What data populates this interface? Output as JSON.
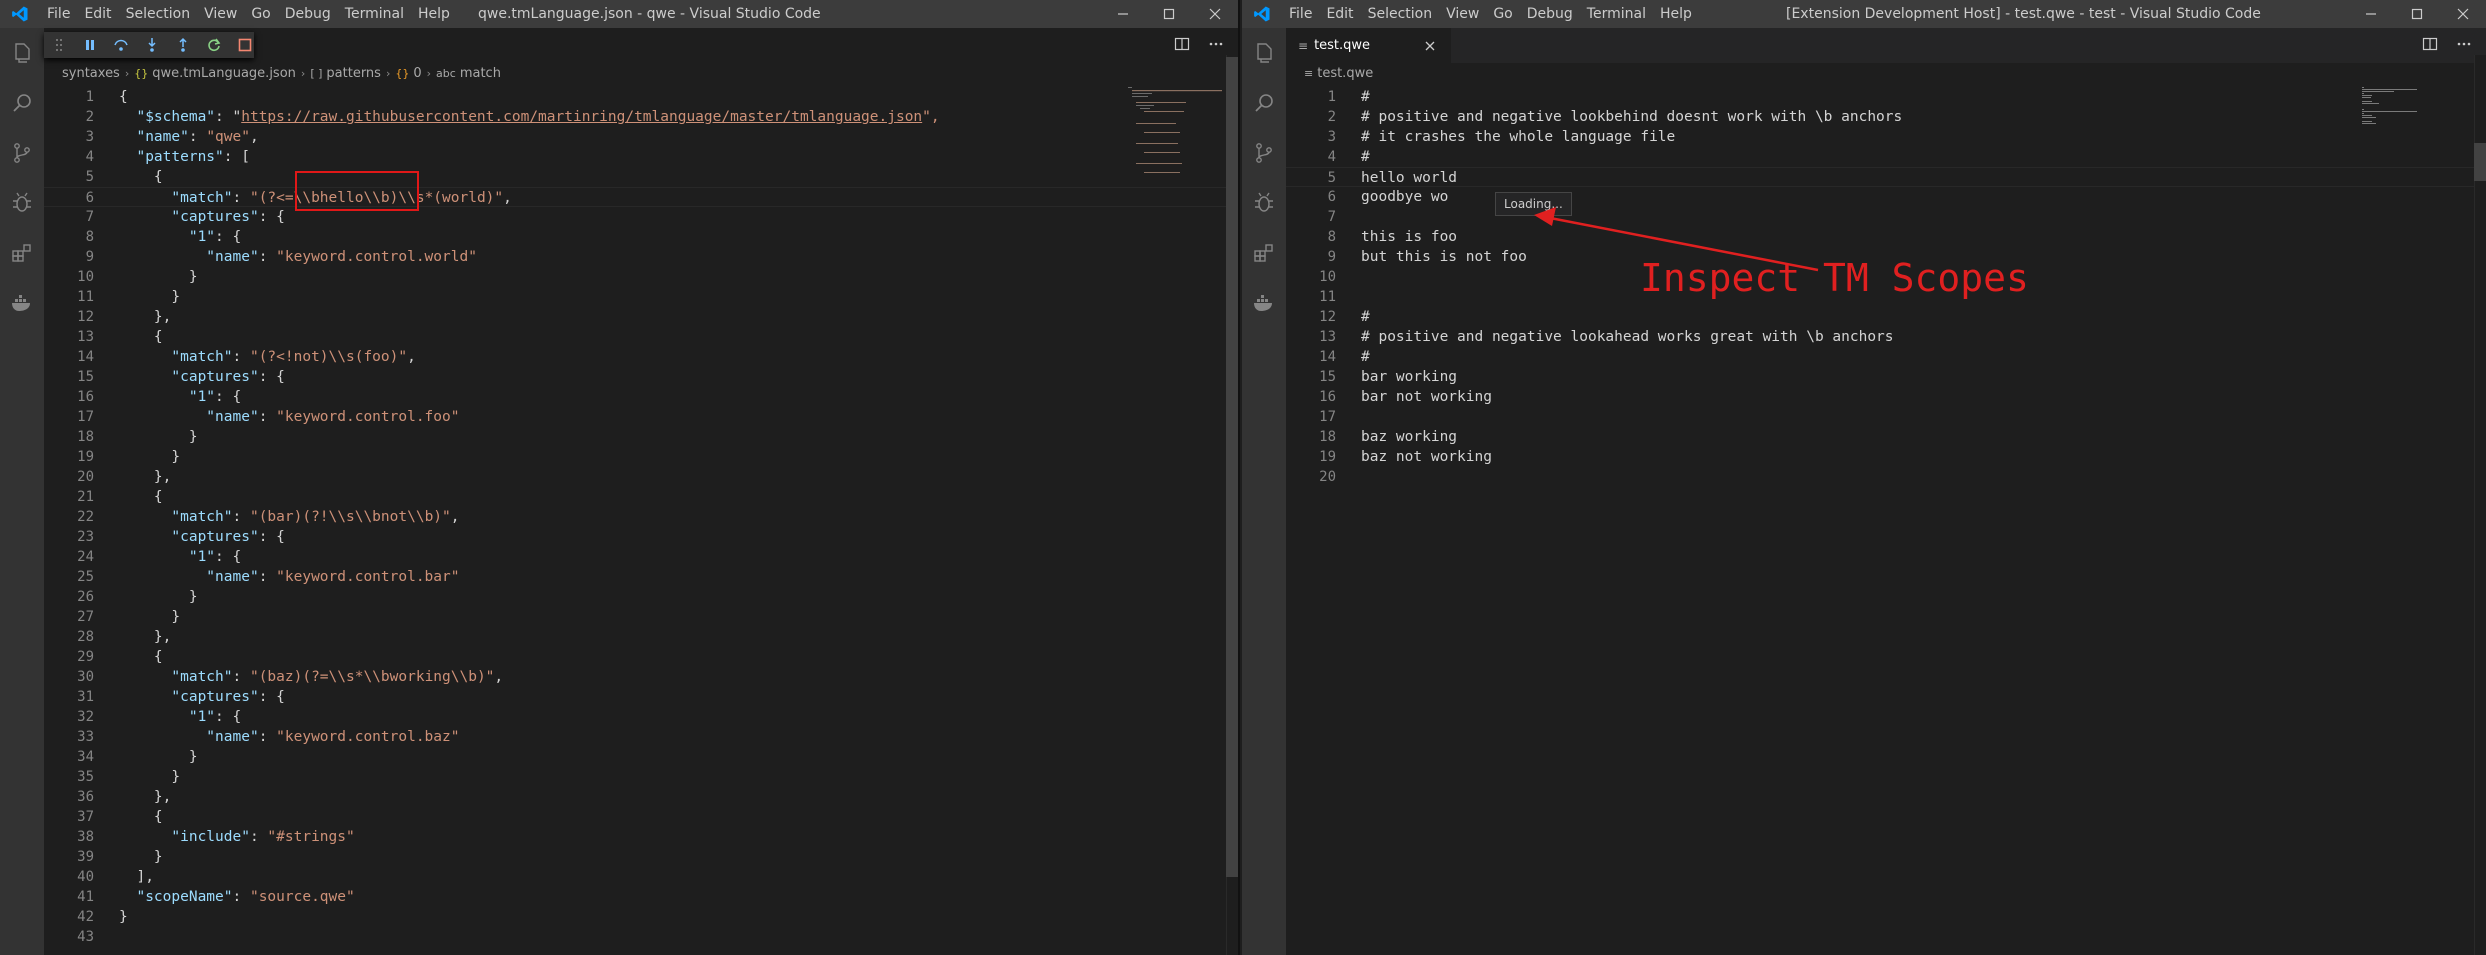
{
  "colors": {
    "accent_blue": "#007acc",
    "annotation_red": "#e02020",
    "key": "#9cdcfe",
    "string": "#ce9178",
    "punct": "#d4d4d4"
  },
  "left_window": {
    "menu": [
      "File",
      "Edit",
      "Selection",
      "View",
      "Go",
      "Debug",
      "Terminal",
      "Help"
    ],
    "title": "qwe.tmLanguage.json - qwe - Visual Studio Code",
    "breadcrumbs": [
      "syntaxes",
      "qwe.tmLanguage.json",
      "patterns",
      "0",
      "match"
    ],
    "breadcrumb_icons": [
      "{}",
      "[ ]",
      "{}",
      "abc"
    ],
    "code_lines": [
      [
        {
          "t": "{",
          "c": "p"
        }
      ],
      [
        {
          "t": "  \"$schema\"",
          "c": "k"
        },
        {
          "t": ": \"",
          "c": "p"
        },
        {
          "t": "https://raw.githubusercontent.com/martinring/tmlanguage/master/tmlanguage.json",
          "c": "u"
        },
        {
          "t": "\",",
          "c": "s"
        }
      ],
      [
        {
          "t": "  \"name\"",
          "c": "k"
        },
        {
          "t": ": ",
          "c": "p"
        },
        {
          "t": "\"qwe\"",
          "c": "s"
        },
        {
          "t": ",",
          "c": "p"
        }
      ],
      [
        {
          "t": "  \"patterns\"",
          "c": "k"
        },
        {
          "t": ": [",
          "c": "p"
        }
      ],
      [
        {
          "t": "    {",
          "c": "p"
        }
      ],
      [
        {
          "t": "      \"match\"",
          "c": "k"
        },
        {
          "t": ": ",
          "c": "p"
        },
        {
          "t": "\"(?<=\\\\bhello\\\\b)\\\\s*(world)\"",
          "c": "s"
        },
        {
          "t": ",",
          "c": "p"
        }
      ],
      [
        {
          "t": "      \"captures\"",
          "c": "k"
        },
        {
          "t": ": {",
          "c": "p"
        }
      ],
      [
        {
          "t": "        \"1\"",
          "c": "k"
        },
        {
          "t": ": {",
          "c": "p"
        }
      ],
      [
        {
          "t": "          \"name\"",
          "c": "k"
        },
        {
          "t": ": ",
          "c": "p"
        },
        {
          "t": "\"keyword.control.world\"",
          "c": "s"
        }
      ],
      [
        {
          "t": "        }",
          "c": "p"
        }
      ],
      [
        {
          "t": "      }",
          "c": "p"
        }
      ],
      [
        {
          "t": "    },",
          "c": "p"
        }
      ],
      [
        {
          "t": "    {",
          "c": "p"
        }
      ],
      [
        {
          "t": "      \"match\"",
          "c": "k"
        },
        {
          "t": ": ",
          "c": "p"
        },
        {
          "t": "\"(?<!not)\\\\s(foo)\"",
          "c": "s"
        },
        {
          "t": ",",
          "c": "p"
        }
      ],
      [
        {
          "t": "      \"captures\"",
          "c": "k"
        },
        {
          "t": ": {",
          "c": "p"
        }
      ],
      [
        {
          "t": "        \"1\"",
          "c": "k"
        },
        {
          "t": ": {",
          "c": "p"
        }
      ],
      [
        {
          "t": "          \"name\"",
          "c": "k"
        },
        {
          "t": ": ",
          "c": "p"
        },
        {
          "t": "\"keyword.control.foo\"",
          "c": "s"
        }
      ],
      [
        {
          "t": "        }",
          "c": "p"
        }
      ],
      [
        {
          "t": "      }",
          "c": "p"
        }
      ],
      [
        {
          "t": "    },",
          "c": "p"
        }
      ],
      [
        {
          "t": "    {",
          "c": "p"
        }
      ],
      [
        {
          "t": "      \"match\"",
          "c": "k"
        },
        {
          "t": ": ",
          "c": "p"
        },
        {
          "t": "\"(bar)(?!\\\\s\\\\bnot\\\\b)\"",
          "c": "s"
        },
        {
          "t": ",",
          "c": "p"
        }
      ],
      [
        {
          "t": "      \"captures\"",
          "c": "k"
        },
        {
          "t": ": {",
          "c": "p"
        }
      ],
      [
        {
          "t": "        \"1\"",
          "c": "k"
        },
        {
          "t": ": {",
          "c": "p"
        }
      ],
      [
        {
          "t": "          \"name\"",
          "c": "k"
        },
        {
          "t": ": ",
          "c": "p"
        },
        {
          "t": "\"keyword.control.bar\"",
          "c": "s"
        }
      ],
      [
        {
          "t": "        }",
          "c": "p"
        }
      ],
      [
        {
          "t": "      }",
          "c": "p"
        }
      ],
      [
        {
          "t": "    },",
          "c": "p"
        }
      ],
      [
        {
          "t": "    {",
          "c": "p"
        }
      ],
      [
        {
          "t": "      \"match\"",
          "c": "k"
        },
        {
          "t": ": ",
          "c": "p"
        },
        {
          "t": "\"(baz)(?=\\\\s*\\\\bworking\\\\b)\"",
          "c": "s"
        },
        {
          "t": ",",
          "c": "p"
        }
      ],
      [
        {
          "t": "      \"captures\"",
          "c": "k"
        },
        {
          "t": ": {",
          "c": "p"
        }
      ],
      [
        {
          "t": "        \"1\"",
          "c": "k"
        },
        {
          "t": ": {",
          "c": "p"
        }
      ],
      [
        {
          "t": "          \"name\"",
          "c": "k"
        },
        {
          "t": ": ",
          "c": "p"
        },
        {
          "t": "\"keyword.control.baz\"",
          "c": "s"
        }
      ],
      [
        {
          "t": "        }",
          "c": "p"
        }
      ],
      [
        {
          "t": "      }",
          "c": "p"
        }
      ],
      [
        {
          "t": "    },",
          "c": "p"
        }
      ],
      [
        {
          "t": "    {",
          "c": "p"
        }
      ],
      [
        {
          "t": "      \"include\"",
          "c": "k"
        },
        {
          "t": ": ",
          "c": "p"
        },
        {
          "t": "\"#strings\"",
          "c": "s"
        }
      ],
      [
        {
          "t": "    }",
          "c": "p"
        }
      ],
      [
        {
          "t": "  ],",
          "c": "p"
        }
      ],
      [
        {
          "t": "  \"scopeName\"",
          "c": "k"
        },
        {
          "t": ": ",
          "c": "p"
        },
        {
          "t": "\"source.qwe\"",
          "c": "s"
        }
      ],
      [
        {
          "t": "}",
          "c": "p"
        }
      ],
      [
        {
          "t": "",
          "c": "p"
        }
      ]
    ]
  },
  "right_window": {
    "menu": [
      "File",
      "Edit",
      "Selection",
      "View",
      "Go",
      "Debug",
      "Terminal",
      "Help"
    ],
    "title": "[Extension Development Host] - test.qwe - test - Visual Studio Code",
    "tab_label": "test.qwe",
    "breadcrumb": "test.qwe",
    "code_lines": [
      "#",
      "# positive and negative lookbehind doesnt work with \\b anchors",
      "# it crashes the whole language file",
      "#",
      "hello world",
      "goodbye wo",
      "",
      "this is foo",
      "but this is not foo",
      "",
      "",
      "#",
      "# positive and negative lookahead works great with \\b anchors",
      "#",
      "bar working",
      "bar not working",
      "",
      "baz working",
      "baz not working",
      ""
    ],
    "hover_text": "Loading...",
    "annotation": "Inspect TM Scopes"
  }
}
